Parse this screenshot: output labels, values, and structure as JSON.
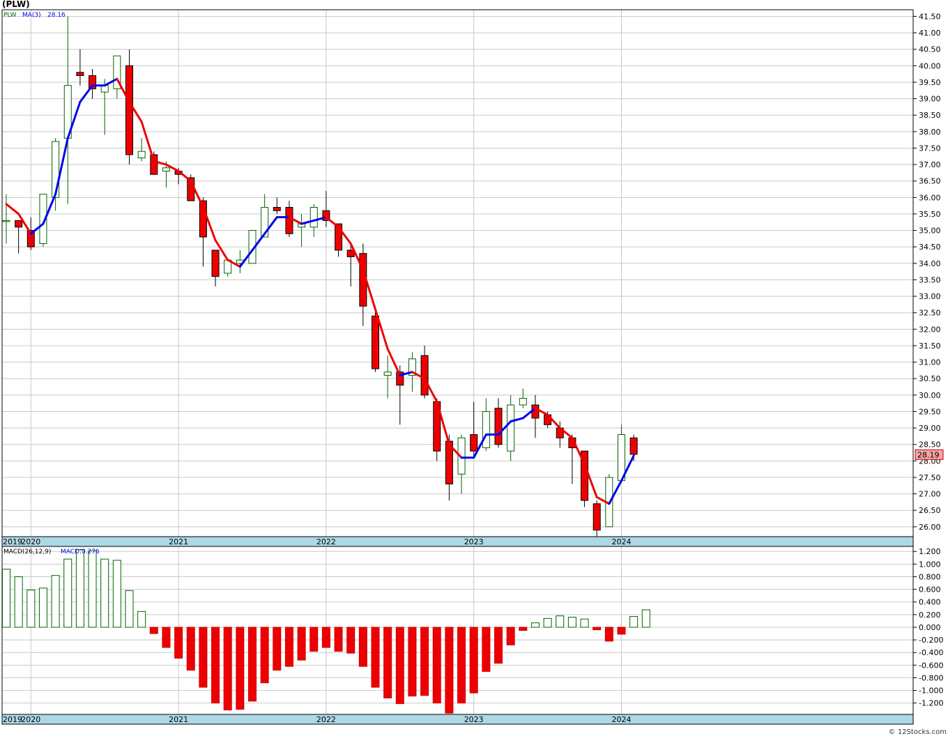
{
  "header": {
    "title": "(PLW)",
    "legend_symbol": "PLW",
    "legend_ma": "MA(3)",
    "legend_ma_value": "28.16",
    "macd_label": "MACD(26,12,9)",
    "macd_value_label": "MACD:0.276",
    "credit": "© 12Stocks.com"
  },
  "chart_data": [
    {
      "type": "candlestick",
      "symbol": "PLW",
      "frequency": "monthly",
      "ylim": [
        25.7,
        41.7
      ],
      "y_ticks": [
        "26.00",
        "26.50",
        "27.00",
        "27.50",
        "28.00",
        "28.50",
        "29.00",
        "29.50",
        "30.00",
        "30.50",
        "31.00",
        "31.50",
        "32.00",
        "32.50",
        "33.00",
        "33.50",
        "34.00",
        "34.50",
        "35.00",
        "35.50",
        "36.00",
        "36.50",
        "37.00",
        "37.50",
        "38.00",
        "38.50",
        "39.00",
        "39.50",
        "40.00",
        "40.50",
        "41.00",
        "41.50"
      ],
      "x_year_labels": [
        "2019",
        "2020",
        "2021",
        "2022",
        "2023",
        "2024"
      ],
      "last_price_label": "28.19",
      "colors": {
        "up_body": "#ffffff",
        "up_wick": "#006400",
        "down_body": "#ee0000",
        "down_wick": "#000000",
        "ma_up": "#0000ee",
        "ma_down": "#ee0000",
        "panel_bg": "#ffffff",
        "axis_band": "#add8e6",
        "grid": "#c8c8c8"
      },
      "candles": [
        {
          "date": "2019-11",
          "open": 35.3,
          "high": 36.1,
          "low": 34.6,
          "close": 35.3
        },
        {
          "date": "2019-12",
          "open": 35.3,
          "high": 35.3,
          "low": 34.3,
          "close": 35.1
        },
        {
          "date": "2020-01",
          "open": 35.0,
          "high": 35.4,
          "low": 34.4,
          "close": 34.5
        },
        {
          "date": "2020-02",
          "open": 34.6,
          "high": 36.1,
          "low": 34.5,
          "close": 36.1
        },
        {
          "date": "2020-03",
          "open": 36.0,
          "high": 37.8,
          "low": 35.6,
          "close": 37.7
        },
        {
          "date": "2020-04",
          "open": 37.8,
          "high": 41.5,
          "low": 35.8,
          "close": 39.4
        },
        {
          "date": "2020-05",
          "open": 39.8,
          "high": 40.5,
          "low": 39.4,
          "close": 39.7
        },
        {
          "date": "2020-06",
          "open": 39.7,
          "high": 39.9,
          "low": 39.0,
          "close": 39.3
        },
        {
          "date": "2020-07",
          "open": 39.2,
          "high": 39.6,
          "low": 37.9,
          "close": 39.4
        },
        {
          "date": "2020-08",
          "open": 39.3,
          "high": 40.3,
          "low": 39.0,
          "close": 40.3
        },
        {
          "date": "2020-09",
          "open": 40.0,
          "high": 40.5,
          "low": 37.0,
          "close": 37.3
        },
        {
          "date": "2020-10",
          "open": 37.2,
          "high": 37.8,
          "low": 37.1,
          "close": 37.4
        },
        {
          "date": "2020-11",
          "open": 37.3,
          "high": 37.4,
          "low": 36.7,
          "close": 36.7
        },
        {
          "date": "2020-12",
          "open": 36.8,
          "high": 37.1,
          "low": 36.3,
          "close": 36.9
        },
        {
          "date": "2021-01",
          "open": 36.8,
          "high": 36.9,
          "low": 36.4,
          "close": 36.7
        },
        {
          "date": "2021-02",
          "open": 36.6,
          "high": 36.7,
          "low": 35.9,
          "close": 35.9
        },
        {
          "date": "2021-03",
          "open": 35.9,
          "high": 36.0,
          "low": 33.9,
          "close": 34.8
        },
        {
          "date": "2021-04",
          "open": 34.4,
          "high": 34.4,
          "low": 33.3,
          "close": 33.6
        },
        {
          "date": "2021-05",
          "open": 33.7,
          "high": 34.1,
          "low": 33.6,
          "close": 34.1
        },
        {
          "date": "2021-06",
          "open": 34.0,
          "high": 34.4,
          "low": 33.7,
          "close": 34.1
        },
        {
          "date": "2021-07",
          "open": 34.0,
          "high": 35.0,
          "low": 34.0,
          "close": 35.0
        },
        {
          "date": "2021-08",
          "open": 34.8,
          "high": 36.1,
          "low": 34.8,
          "close": 35.7
        },
        {
          "date": "2021-09",
          "open": 35.7,
          "high": 36.0,
          "low": 35.5,
          "close": 35.6
        },
        {
          "date": "2021-10",
          "open": 35.7,
          "high": 35.9,
          "low": 34.8,
          "close": 34.9
        },
        {
          "date": "2021-11",
          "open": 35.1,
          "high": 35.5,
          "low": 34.5,
          "close": 35.2
        },
        {
          "date": "2021-12",
          "open": 35.1,
          "high": 35.8,
          "low": 34.8,
          "close": 35.7
        },
        {
          "date": "2022-01",
          "open": 35.6,
          "high": 36.2,
          "low": 35.1,
          "close": 35.3
        },
        {
          "date": "2022-02",
          "open": 35.2,
          "high": 35.2,
          "low": 34.2,
          "close": 34.4
        },
        {
          "date": "2022-03",
          "open": 34.4,
          "high": 34.6,
          "low": 33.3,
          "close": 34.2
        },
        {
          "date": "2022-04",
          "open": 34.3,
          "high": 34.6,
          "low": 32.1,
          "close": 32.7
        },
        {
          "date": "2022-05",
          "open": 32.4,
          "high": 32.7,
          "low": 30.7,
          "close": 30.8
        },
        {
          "date": "2022-06",
          "open": 30.6,
          "high": 31.2,
          "low": 29.9,
          "close": 30.7
        },
        {
          "date": "2022-07",
          "open": 30.7,
          "high": 30.9,
          "low": 29.1,
          "close": 30.3
        },
        {
          "date": "2022-08",
          "open": 30.6,
          "high": 31.3,
          "low": 30.1,
          "close": 31.1
        },
        {
          "date": "2022-09",
          "open": 31.2,
          "high": 31.5,
          "low": 29.9,
          "close": 30.0
        },
        {
          "date": "2022-10",
          "open": 29.8,
          "high": 29.9,
          "low": 28.0,
          "close": 28.3
        },
        {
          "date": "2022-11",
          "open": 28.6,
          "high": 28.8,
          "low": 26.8,
          "close": 27.3
        },
        {
          "date": "2022-12",
          "open": 27.6,
          "high": 28.8,
          "low": 27.0,
          "close": 28.7
        },
        {
          "date": "2023-01",
          "open": 28.8,
          "high": 29.8,
          "low": 28.1,
          "close": 28.3
        },
        {
          "date": "2023-02",
          "open": 28.4,
          "high": 29.9,
          "low": 28.3,
          "close": 29.5
        },
        {
          "date": "2023-03",
          "open": 29.6,
          "high": 29.9,
          "low": 28.4,
          "close": 28.5
        },
        {
          "date": "2023-04",
          "open": 28.3,
          "high": 30.0,
          "low": 28.0,
          "close": 29.7
        },
        {
          "date": "2023-05",
          "open": 29.7,
          "high": 30.2,
          "low": 29.6,
          "close": 29.9
        },
        {
          "date": "2023-06",
          "open": 29.7,
          "high": 30.0,
          "low": 28.7,
          "close": 29.3
        },
        {
          "date": "2023-07",
          "open": 29.4,
          "high": 29.5,
          "low": 29.0,
          "close": 29.1
        },
        {
          "date": "2023-08",
          "open": 29.0,
          "high": 29.2,
          "low": 28.4,
          "close": 28.7
        },
        {
          "date": "2023-09",
          "open": 28.7,
          "high": 28.8,
          "low": 27.3,
          "close": 28.4
        },
        {
          "date": "2023-10",
          "open": 28.3,
          "high": 28.3,
          "low": 26.6,
          "close": 26.8
        },
        {
          "date": "2023-11",
          "open": 26.7,
          "high": 26.8,
          "low": 25.7,
          "close": 25.9
        },
        {
          "date": "2023-12",
          "open": 26.0,
          "high": 27.6,
          "low": 26.0,
          "close": 27.5
        },
        {
          "date": "2024-01",
          "open": 27.4,
          "high": 29.1,
          "low": 27.4,
          "close": 28.8
        },
        {
          "date": "2024-02",
          "open": 28.7,
          "high": 28.8,
          "low": 28.0,
          "close": 28.2
        }
      ],
      "ma3": [
        35.8,
        35.5,
        34.9,
        35.2,
        36.1,
        37.8,
        38.9,
        39.4,
        39.4,
        39.6,
        38.9,
        38.3,
        37.1,
        37.0,
        36.8,
        36.5,
        35.7,
        34.7,
        34.1,
        33.9,
        34.4,
        34.9,
        35.4,
        35.4,
        35.2,
        35.3,
        35.4,
        35.1,
        34.6,
        33.8,
        32.6,
        31.4,
        30.6,
        30.7,
        30.5,
        29.8,
        28.5,
        28.1,
        28.1,
        28.8,
        28.8,
        29.2,
        29.3,
        29.6,
        29.4,
        29.0,
        28.7,
        27.9,
        26.9,
        26.7,
        27.4,
        28.16
      ],
      "ma3_color_by_segment": "blue when rising, red when falling"
    },
    {
      "type": "bar",
      "name": "MACD(26,12,9)",
      "ylim": [
        -1.38,
        1.28
      ],
      "y_ticks": [
        "1.200",
        "1.000",
        "0.800",
        "0.600",
        "0.400",
        "0.200",
        "0.000",
        "-0.200",
        "-0.400",
        "-0.600",
        "-0.800",
        "-1.000",
        "-1.200"
      ],
      "x_year_labels": [
        "2019",
        "2020",
        "2021",
        "2022",
        "2023",
        "2024"
      ],
      "values": [
        0.92,
        0.8,
        0.59,
        0.62,
        0.82,
        1.08,
        1.23,
        1.21,
        1.08,
        1.06,
        0.58,
        0.25,
        -0.1,
        -0.32,
        -0.49,
        -0.68,
        -0.95,
        -1.2,
        -1.31,
        -1.3,
        -1.17,
        -0.88,
        -0.68,
        -0.62,
        -0.52,
        -0.38,
        -0.32,
        -0.38,
        -0.41,
        -0.62,
        -0.95,
        -1.12,
        -1.21,
        -1.09,
        -1.08,
        -1.2,
        -1.36,
        -1.2,
        -1.04,
        -0.7,
        -0.57,
        -0.28,
        -0.05,
        0.07,
        0.14,
        0.18,
        0.16,
        0.13,
        -0.04,
        -0.22,
        -0.11,
        0.17,
        0.276
      ]
    }
  ]
}
